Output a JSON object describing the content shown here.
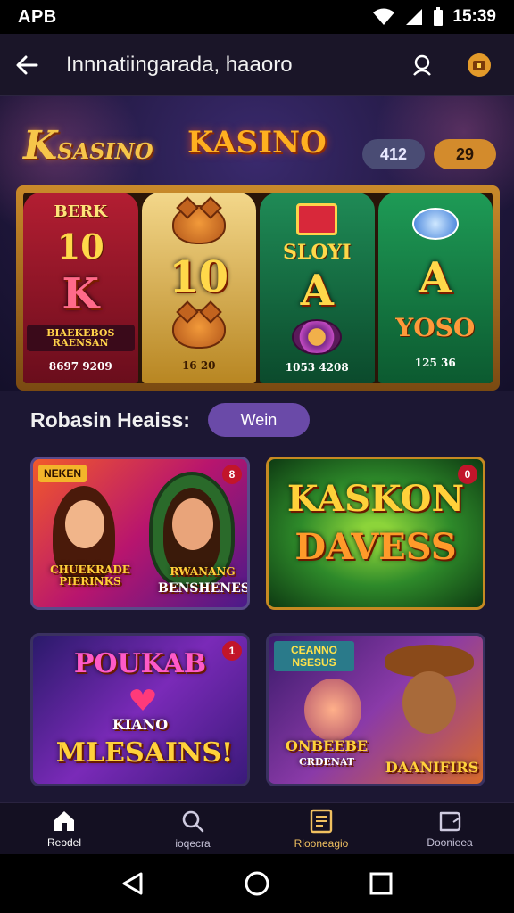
{
  "status_bar": {
    "carrier": "APB",
    "time": "15:39"
  },
  "app_bar": {
    "title": "Innnatiingarada, haaoro"
  },
  "hero": {
    "logo_left_big": "K",
    "logo_left_rest": "SASINO",
    "logo_center": "KASINO",
    "balance": "412",
    "coins": "29",
    "reels": [
      {
        "top": "BERK",
        "big": "10",
        "mid": "K",
        "label": "BIAEKEBOS RAENSAN",
        "small": "8697 9209"
      },
      {
        "big": "10",
        "small": "16 20"
      },
      {
        "mid": "SLOYI",
        "big": "A",
        "small": "1053 4208"
      },
      {
        "big": "A",
        "mid": "YOSO",
        "small": "125 36"
      }
    ]
  },
  "section": {
    "title": "Robasin Heaiss:",
    "button_label": "Wein"
  },
  "cards": [
    {
      "tag": "NEKEN",
      "badge": "8",
      "title": "CHUEKRADE PIERINKS",
      "subtitle": "BENSHENES",
      "sub_top": "RWANANG"
    },
    {
      "badge": "0",
      "title": "KASKON",
      "subtitle": "DAVESS"
    },
    {
      "badge": "1",
      "title": "POUKAB",
      "mid": "KIANO",
      "subtitle": "MLESAINS!"
    },
    {
      "tag": "CEANNO NSESUS",
      "title": "ONBEEBE",
      "mid": "CRDENAT",
      "subtitle": "DAANIFIRS"
    }
  ],
  "bottom_nav": [
    {
      "label": "Reodel",
      "icon": "home-icon"
    },
    {
      "label": "ioqecra",
      "icon": "search-icon"
    },
    {
      "label": "Rlooneagio",
      "icon": "list-icon"
    },
    {
      "label": "Doonieea",
      "icon": "wallet-icon"
    }
  ],
  "colors": {
    "accent": "#6a4aa8",
    "gold": "#f6c64a",
    "background": "#1c1733"
  }
}
